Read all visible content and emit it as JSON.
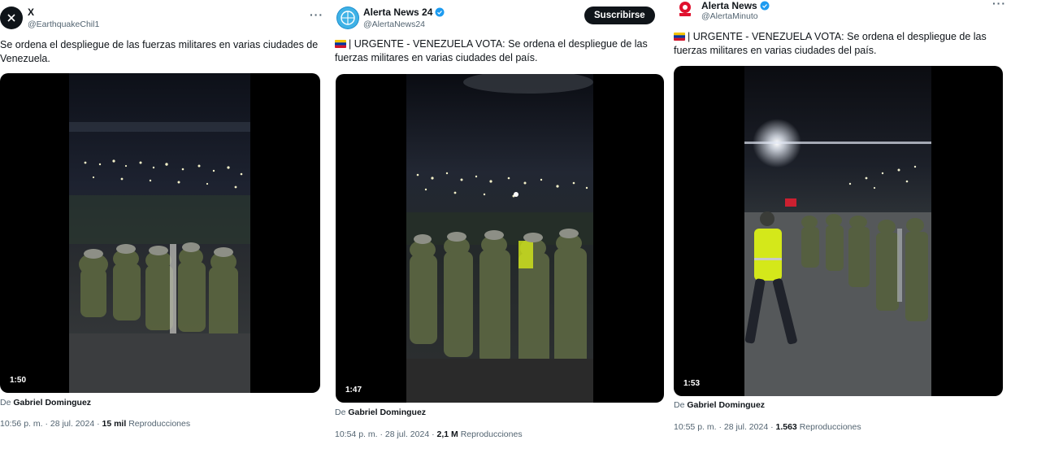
{
  "posts": [
    {
      "name": "X",
      "handle": "@EarthquakeChil1",
      "verified": false,
      "text": "Se ordena el despliegue de las fuerzas militares en varias ciudades de Venezuela.",
      "duration": "1:50",
      "byline_prefix": "De",
      "byline_author": "Gabriel Dominguez",
      "time": "10:56 p. m. · 28 jul. 2024 ·",
      "views": "15 mil",
      "views_label": "Reproducciones"
    },
    {
      "name": "Alerta News 24",
      "handle": "@AlertaNews24",
      "verified": true,
      "subscribe_label": "Suscribirse",
      "text": "| URGENTE - VENEZUELA VOTA: Se ordena el despliegue de las fuerzas militares en varias ciudades del país.",
      "duration": "1:47",
      "byline_prefix": "De",
      "byline_author": "Gabriel Dominguez",
      "time": "10:54 p. m. · 28 jul. 2024 ·",
      "views": "2,1 M",
      "views_label": "Reproducciones"
    },
    {
      "name": "Alerta News",
      "handle": "@AlertaMinuto",
      "verified": true,
      "text": "| URGENTE - VENEZUELA VOTA: Se ordena el despliegue de las fuerzas militares en varias ciudades del país.",
      "duration": "1:53",
      "byline_prefix": "De",
      "byline_author": "Gabriel Dominguez",
      "time": "10:55 p. m. · 28 jul. 2024 ·",
      "views": "1.563",
      "views_label": "Reproducciones"
    }
  ],
  "more_glyph": "···",
  "colors": {
    "verified": "#1d9bf0",
    "text": "#0f1419",
    "muted": "#536471",
    "media_bg": "#000000",
    "vest": "#d4e81a",
    "uniform": "#4f5a3c"
  },
  "icons": {
    "verified": "verified-badge-icon",
    "more": "more-options-icon",
    "flag": "venezuela-flag-icon"
  }
}
